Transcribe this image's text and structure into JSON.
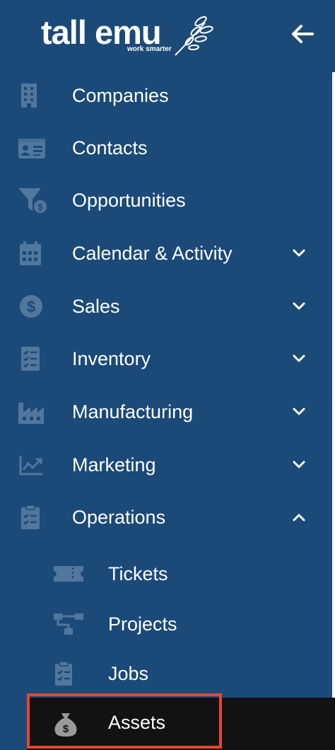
{
  "brand": {
    "name": "tall emu",
    "tagline": "work smarter"
  },
  "colors": {
    "sidebar_bg": "#1b4a78",
    "icon_muted": "#52779c",
    "active_bg": "#121212",
    "highlight": "#e8472a"
  },
  "header": {
    "collapse_icon": "arrow-left-icon"
  },
  "nav": {
    "items": [
      {
        "label": "Companies",
        "icon": "building-icon"
      },
      {
        "label": "Contacts",
        "icon": "id-card-icon"
      },
      {
        "label": "Opportunities",
        "icon": "funnel-dollar-icon"
      },
      {
        "label": "Calendar & Activity",
        "icon": "calendar-icon",
        "expandable": true
      },
      {
        "label": "Sales",
        "icon": "dollar-circle-icon",
        "expandable": true
      },
      {
        "label": "Inventory",
        "icon": "checklist-icon",
        "expandable": true
      },
      {
        "label": "Manufacturing",
        "icon": "factory-icon",
        "expandable": true
      },
      {
        "label": "Marketing",
        "icon": "trend-chart-icon",
        "expandable": true
      },
      {
        "label": "Operations",
        "icon": "clipboard-icon",
        "expanded": true
      }
    ],
    "operations_children": [
      {
        "label": "Tickets",
        "icon": "ticket-icon"
      },
      {
        "label": "Projects",
        "icon": "project-tree-icon"
      },
      {
        "label": "Jobs",
        "icon": "clipboard-list-icon"
      },
      {
        "label": "Assets",
        "icon": "money-bag-icon",
        "active": true
      }
    ]
  }
}
